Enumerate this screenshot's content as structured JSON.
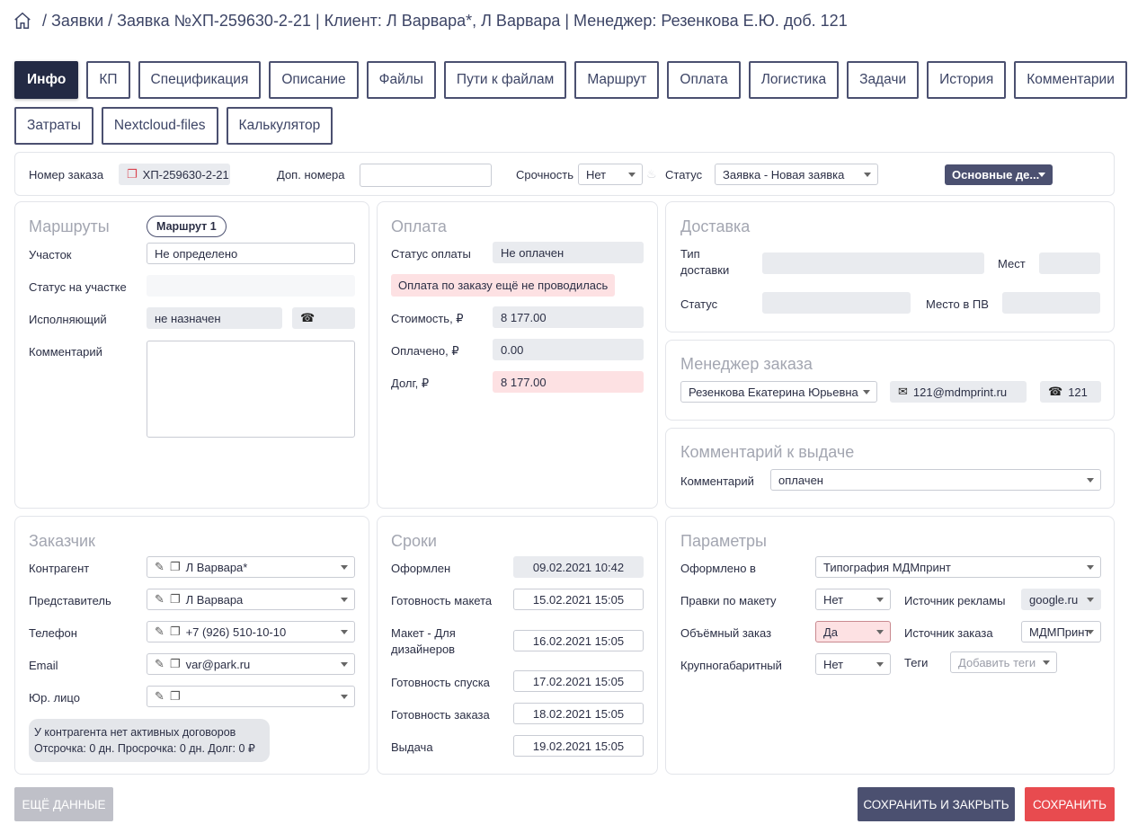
{
  "breadcrumb": {
    "items": [
      "Заявки",
      "Заявка №ХП-259630-2-21 | Клиент: Л Варвара*, Л Варвара | Менеджер: Резенкова Е.Ю. доб. 121"
    ]
  },
  "tabs": [
    "Инфо",
    "КП",
    "Спецификация",
    "Описание",
    "Файлы",
    "Пути к файлам",
    "Маршрут",
    "Оплата",
    "Логистика",
    "Задачи",
    "История",
    "Комментарии",
    "Затраты",
    "Nextcloud-files",
    "Калькулятор"
  ],
  "topbar": {
    "order_number_label": "Номер заказа",
    "order_number_value": "ХП-259630-2-21",
    "extra_numbers_label": "Доп. номера",
    "extra_numbers_value": "",
    "urgency_label": "Срочность",
    "urgency_value": "Нет",
    "status_label": "Статус",
    "status_value": "Заявка - Новая заявка",
    "actions_dropdown": "Основные де..."
  },
  "routes": {
    "title": "Маршруты",
    "route_pill": "Маршрут 1",
    "section_label": "Участок",
    "section_value": "Не определено",
    "section_status_label": "Статус на участке",
    "section_status_value": "",
    "executor_label": "Исполняющий",
    "executor_value": "не назначен",
    "executor_phone": "",
    "comment_label": "Комментарий",
    "comment_value": ""
  },
  "payment": {
    "title": "Оплата",
    "status_label": "Статус оплаты",
    "status_value": "Не оплачен",
    "alert": "Оплата по заказу ещё не проводилась",
    "cost_label": "Стоимость, ₽",
    "cost_value": "8 177.00",
    "paid_label": "Оплачено, ₽",
    "paid_value": "0.00",
    "debt_label": "Долг, ₽",
    "debt_value": "8 177.00"
  },
  "delivery": {
    "title": "Доставка",
    "type_label": "Тип доставки",
    "type_value": "",
    "places_label": "Мест",
    "places_value": "",
    "status_label": "Статус",
    "status_value": "",
    "pv_place_label": "Место в ПВ",
    "pv_place_value": ""
  },
  "manager": {
    "title": "Менеджер заказа",
    "name": "Резенкова Екатерина Юрьевна",
    "email": "121@mdmprint.ru",
    "phone": "121"
  },
  "issue_comment": {
    "title": "Комментарий к выдаче",
    "label": "Комментарий",
    "value": "оплачен"
  },
  "customer": {
    "title": "Заказчик",
    "counterparty_label": "Контрагент",
    "counterparty_value": "Л Варвара*",
    "representative_label": "Представитель",
    "representative_value": "Л Варвара",
    "phone_label": "Телефон",
    "phone_value": "+7 (926) 510-10-10",
    "email_label": "Email",
    "email_value": "var@park.ru",
    "legal_label": "Юр. лицо",
    "legal_value": "",
    "info_line1": "У контрагента нет активных договоров",
    "info_line2": "Отсрочка: 0 дн. Просрочка: 0 дн. Долг: 0 ₽"
  },
  "deadlines": {
    "title": "Сроки",
    "created_label": "Оформлен",
    "created_value": "09.02.2021 10:42",
    "layout_ready_label": "Готовность макета",
    "layout_ready_value": "15.02.2021 15:05",
    "layout_designers_label": "Макет - Для дизайнеров",
    "layout_designers_value": "16.02.2021 15:05",
    "release_ready_label": "Готовность спуска",
    "release_ready_value": "17.02.2021 15:05",
    "order_ready_label": "Готовность заказа",
    "order_ready_value": "18.02.2021 15:05",
    "issue_label": "Выдача",
    "issue_value": "19.02.2021 15:05"
  },
  "params": {
    "title": "Параметры",
    "issued_in_label": "Оформлено в",
    "issued_in_value": "Типография МДМпринт",
    "edits_label": "Правки по макету",
    "edits_value": "Нет",
    "ad_source_label": "Источник рекламы",
    "ad_source_value": "google.ru",
    "bulk_label": "Объёмный заказ",
    "bulk_value": "Да",
    "order_source_label": "Источник заказа",
    "order_source_value": "МДМПринт",
    "large_label": "Крупногабаритный",
    "large_value": "Нет",
    "tags_label": "Теги",
    "tags_placeholder": "Добавить теги"
  },
  "footer": {
    "more_data": "Ещё данные",
    "save_close": "Сохранить и закрыть",
    "save": "Сохранить"
  },
  "colors": {
    "navy": "#232a44",
    "accent": "#4b5070",
    "danger": "#e84b4f",
    "pink": "#fde1e3"
  }
}
